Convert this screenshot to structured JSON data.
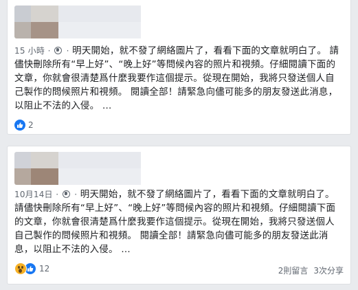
{
  "posts": [
    {
      "timestamp": "15 小時",
      "separator": "·",
      "privacy_icon": "globe-icon",
      "text": "明天開始，就不發了網絡圖片了，看看下面的文章就明白了。 請儘快刪除所有“早上好”、“晚上好”等問候內容的照片和視頻。仔細閱讀下面的文章，你就會很清楚爲什麼我要作這個提示。從現在開始，我將只發送個人自己製作的問候照片和視頻。 閱讀全部！請緊急向儘可能多的朋友發送此消息，以阻止不法的入侵。",
      "ellipsis": "…",
      "reaction_count": "2",
      "reactions": [
        "like-icon"
      ]
    },
    {
      "timestamp": "10月14日",
      "separator": "·",
      "privacy_icon": "globe-icon",
      "text": "明天開始，就不發了網絡圖片了，看看下面的文章就明白了。 請儘快刪除所有“早上好”、“晚上好”等問候內容的照片和視頻。仔細閱讀下面的文章，你就會很清楚爲什麼我要作這個提示。從現在開始，我將只發送個人自己製作的問候照片和視頻。 閱讀全部！請緊急向儘可能多的朋友發送此消息，以阻止不法的入侵。",
      "ellipsis": "…",
      "reaction_count": "12",
      "reactions": [
        "wow-icon",
        "like-icon"
      ],
      "comments": "2則留言",
      "shares": "3次分享"
    }
  ],
  "colors": {
    "background": "#e9ebee",
    "card": "#ffffff",
    "meta_text": "#606770",
    "like_blue": "#1877f2",
    "wow_yellow": "#f7b125"
  }
}
